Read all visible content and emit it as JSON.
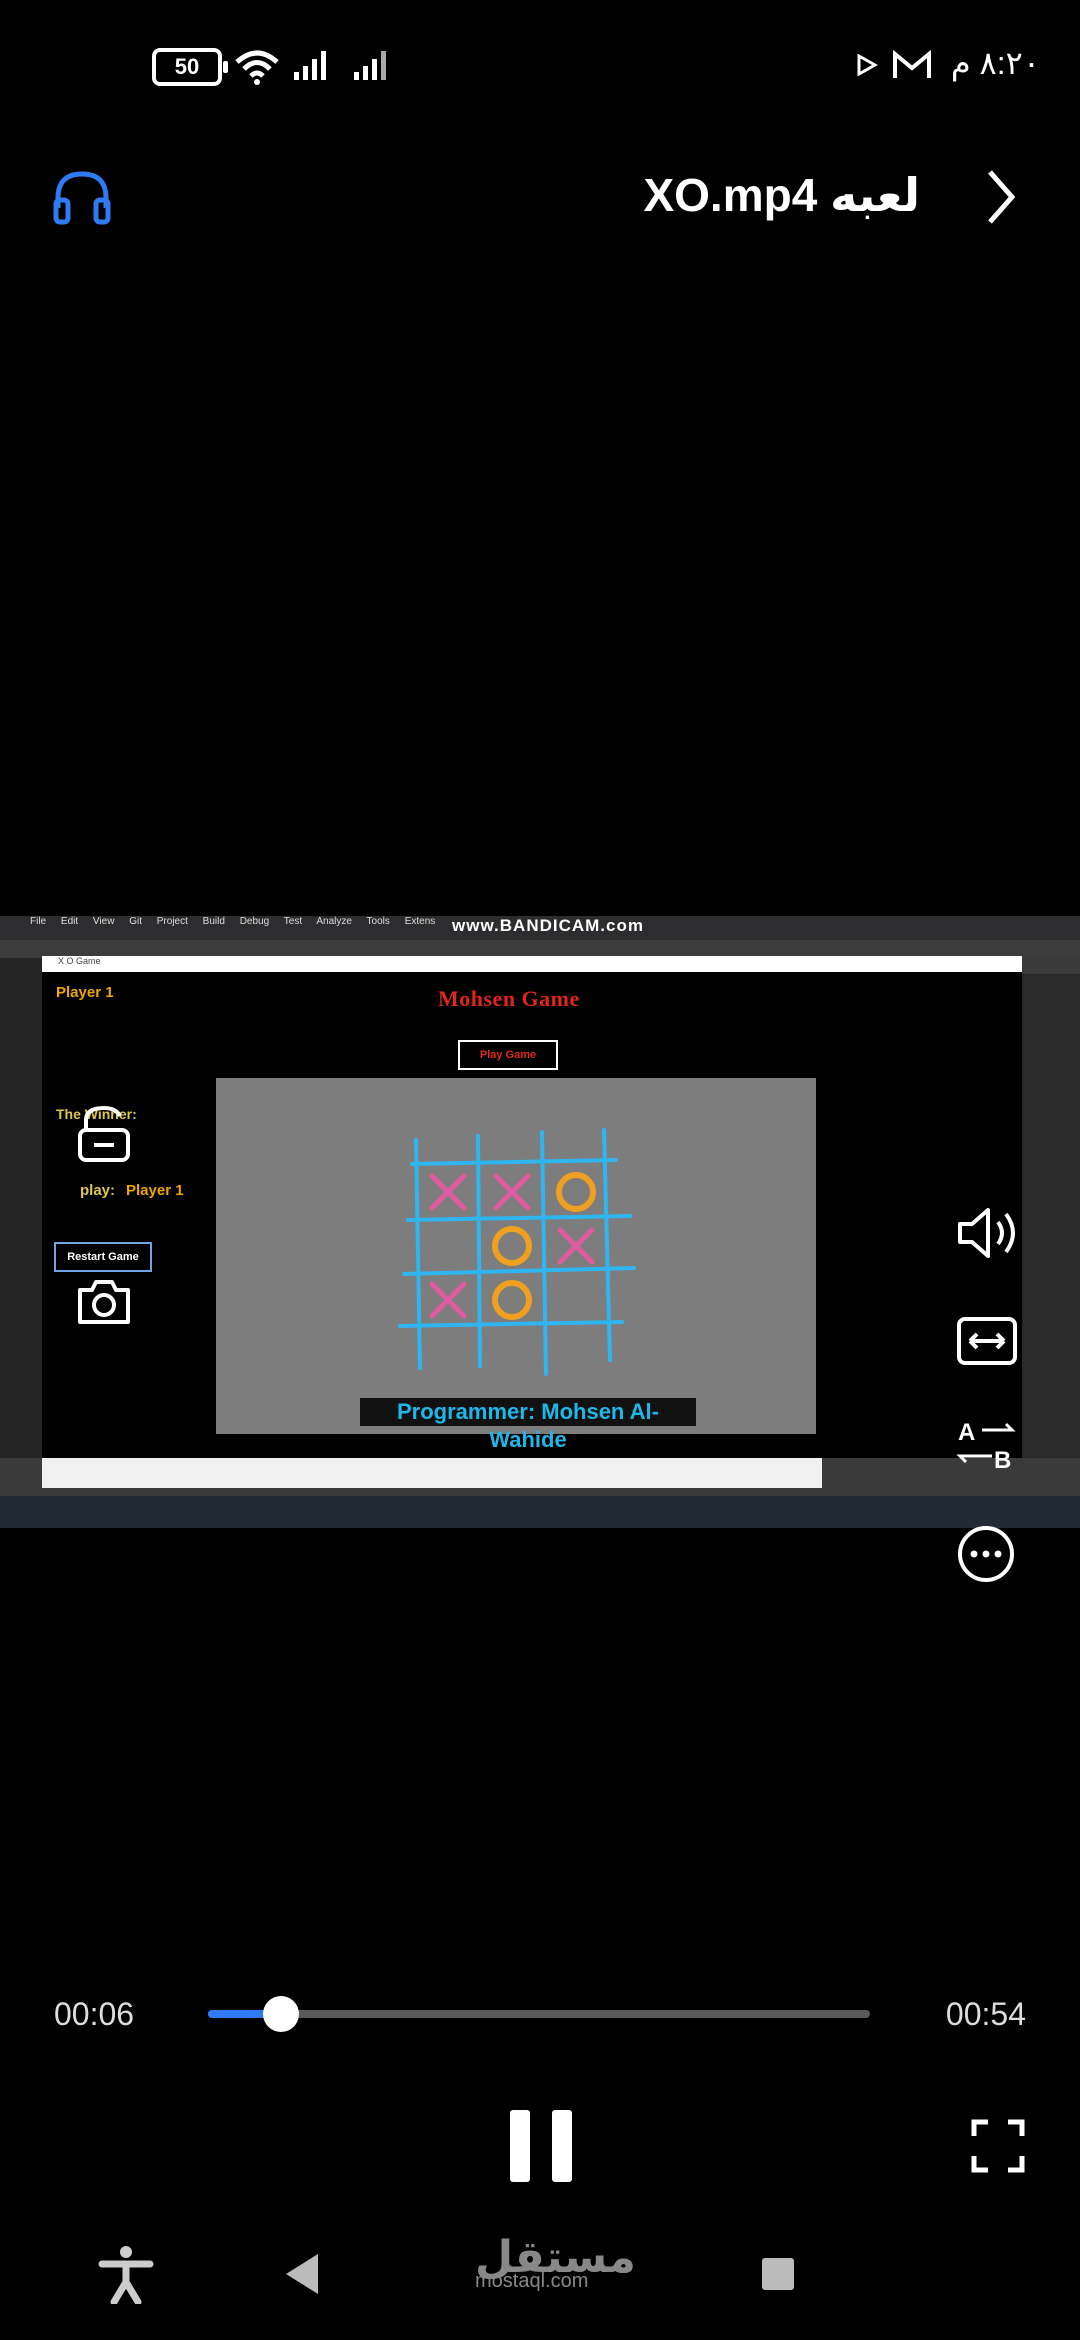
{
  "status_bar": {
    "battery": "50",
    "time": "٨:٢٠ م"
  },
  "header": {
    "title": "لعبه XO.mp4"
  },
  "video": {
    "recording_watermark": "www.BANDICAM.com",
    "ide_menu": [
      "File",
      "Edit",
      "View",
      "Git",
      "Project",
      "Build",
      "Debug",
      "Test",
      "Analyze",
      "Tools",
      "Extens"
    ],
    "form": {
      "window_title": "X O Game",
      "title": "Mohsen Game",
      "player_label": "Player 1",
      "play_button": "Play Game",
      "winner_label": "The Winner:",
      "play_label": "play:",
      "play_value": "Player 1",
      "restart_button": "Restart Game",
      "programmer": "Programmer: Mohsen Al-Wahide"
    },
    "board": [
      "X",
      "X",
      "O",
      "",
      "O",
      "X",
      "X",
      "O",
      ""
    ]
  },
  "overlay": {
    "lock_icon": "lock-icon",
    "camera_icon": "camera-icon",
    "volume_icon": "volume-icon",
    "aspect_icon": "aspect-ratio-icon",
    "ab_icon": "ab-repeat-icon",
    "more_icon": "more-icon"
  },
  "controls": {
    "current_time": "00:06",
    "total_time": "00:54",
    "progress": 0.11
  },
  "nav_bar": {
    "watermark": "مستقل",
    "watermark_sub": "mostaql.com"
  },
  "colors": {
    "accent": "#2f7bf5",
    "x_color": "#e05aa0",
    "o_color": "#f0a020",
    "grid_color": "#2fb5f0"
  }
}
